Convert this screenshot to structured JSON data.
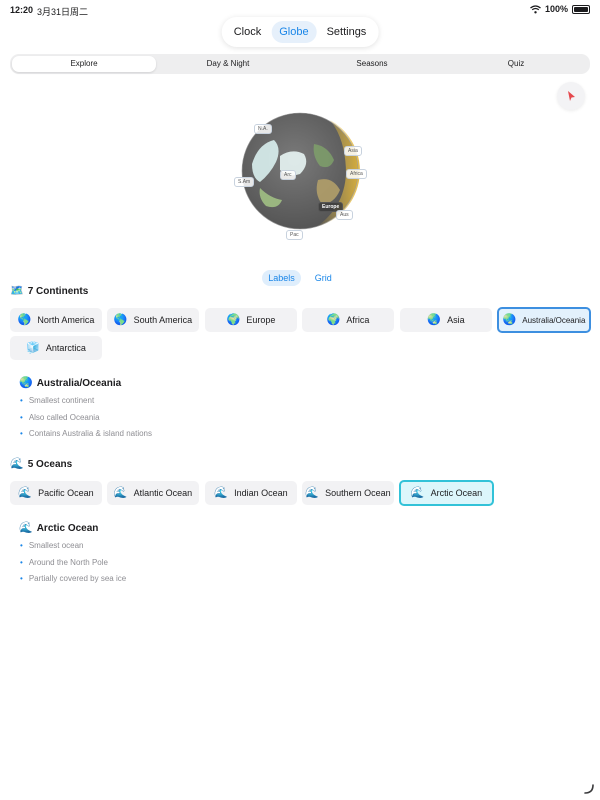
{
  "status": {
    "time": "12:20",
    "date": "3月31日周二",
    "battery": "100%"
  },
  "top_tabs": [
    {
      "label": "Clock",
      "active": false
    },
    {
      "label": "Globe",
      "active": true
    },
    {
      "label": "Settings",
      "active": false
    }
  ],
  "segments": [
    {
      "label": "Explore",
      "active": true
    },
    {
      "label": "Day & Night",
      "active": false
    },
    {
      "label": "Seasons",
      "active": false
    },
    {
      "label": "Quiz",
      "active": false
    }
  ],
  "globe": {
    "labels": [
      "N.A.",
      "Asia",
      "Europe",
      "Africa",
      "S.Am",
      "Aus",
      "Pac",
      "Arc"
    ]
  },
  "globe_toggles": [
    {
      "label": "Labels",
      "active": true
    },
    {
      "label": "Grid",
      "active": false
    }
  ],
  "continents": {
    "icon": "🗺️",
    "title": "7 Continents",
    "items": [
      {
        "icon": "🌎",
        "label": "North America"
      },
      {
        "icon": "🌎",
        "label": "South America"
      },
      {
        "icon": "🌍",
        "label": "Europe"
      },
      {
        "icon": "🌍",
        "label": "Africa"
      },
      {
        "icon": "🌏",
        "label": "Asia"
      },
      {
        "icon": "🌏",
        "label": "Australia/Oceania",
        "selected": true
      },
      {
        "icon": "🧊",
        "label": "Antarctica"
      }
    ],
    "detail": {
      "icon": "🌏",
      "title": "Australia/Oceania",
      "facts": [
        "Smallest continent",
        "Also called Oceania",
        "Contains Australia & island nations"
      ]
    }
  },
  "oceans": {
    "icon": "🌊",
    "title": "5 Oceans",
    "items": [
      {
        "icon": "🌊",
        "label": "Pacific Ocean"
      },
      {
        "icon": "🌊",
        "label": "Atlantic Ocean"
      },
      {
        "icon": "🌊",
        "label": "Indian Ocean"
      },
      {
        "icon": "🌊",
        "label": "Southern Ocean"
      },
      {
        "icon": "🌊",
        "label": "Arctic Ocean",
        "selected": true
      }
    ],
    "detail": {
      "icon": "🌊",
      "title": "Arctic Ocean",
      "facts": [
        "Smallest ocean",
        "Around the North Pole",
        "Partially covered by sea ice"
      ]
    }
  },
  "colors": {
    "accent": "#1a86e8",
    "continent_selected_border": "#3d8fe0",
    "ocean_selected_border": "#32c2d8",
    "chip_bg": "#f2f2f4"
  }
}
